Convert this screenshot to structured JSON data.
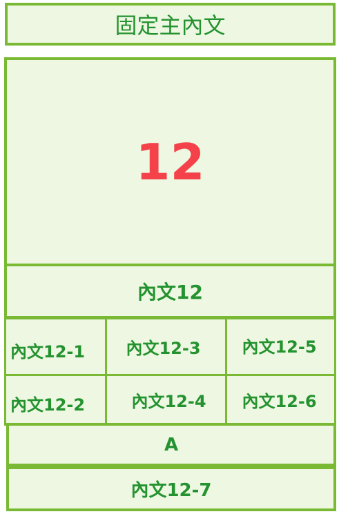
{
  "header": {
    "title": "固定主內文"
  },
  "main": {
    "number": "12"
  },
  "section": {
    "label": "內文12"
  },
  "grid": {
    "c1": "內文12-1",
    "c2": "內文12-2",
    "c3": "內文12-3",
    "c4": "內文12-4",
    "c5": "內文12-5",
    "c6": "內文12-6"
  },
  "footer_a": {
    "label": "A"
  },
  "footer_7": {
    "label": "內文12-7"
  },
  "colors": {
    "border": "#79b934",
    "fill": "#edf7e1",
    "text": "#23922f",
    "accent": "#f5424a"
  }
}
